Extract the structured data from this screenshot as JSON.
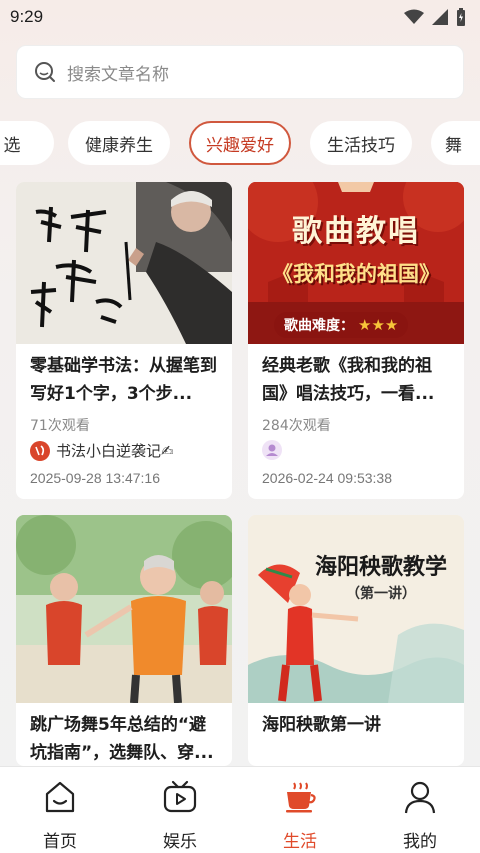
{
  "status_bar": {
    "time": "9:29"
  },
  "search": {
    "placeholder": "搜索文章名称"
  },
  "categories": [
    "选",
    "健康养生",
    "兴趣爱好",
    "生活技巧",
    "舞"
  ],
  "active_category": "兴趣爱好",
  "cards": [
    {
      "title": "零基础学书法：从握笔到写好1个字，3个步...",
      "views": "71次观看",
      "author": "书法小白逆袭记✍",
      "date": "2025-09-28 13:47:16"
    },
    {
      "title": "经典老歌《我和我的祖国》唱法技巧，一看...",
      "views": "284次观看",
      "author": "",
      "date": "2026-02-24 09:53:38",
      "thumb_heading": "歌曲教唱",
      "thumb_song": "《我和我的祖国》",
      "thumb_difficulty": "歌曲难度：",
      "thumb_stars": "★★★"
    },
    {
      "title": "跳广场舞5年总结的“避坑指南”，选舞队、穿..."
    },
    {
      "title": "海阳秧歌第一讲",
      "thumb_heading": "海阳秧歌教学",
      "thumb_sub": "（第一讲）"
    }
  ],
  "nav": [
    {
      "label": "首页",
      "icon": "home-icon"
    },
    {
      "label": "娱乐",
      "icon": "tv-icon"
    },
    {
      "label": "生活",
      "icon": "coffee-cup-icon",
      "active": true
    },
    {
      "label": "我的",
      "icon": "person-icon"
    }
  ],
  "colors": {
    "accent": "#e04a2a",
    "chip_active_border": "#d0583e"
  }
}
